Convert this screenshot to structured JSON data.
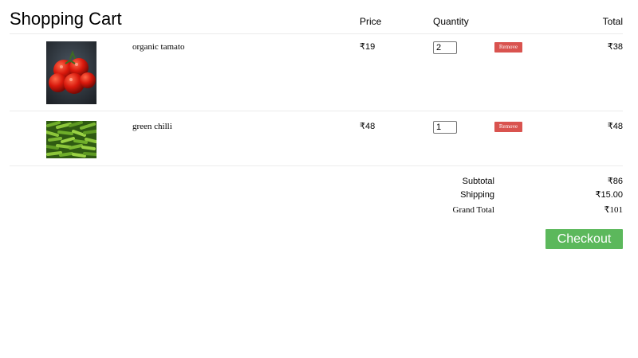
{
  "header": {
    "title": "Shopping Cart",
    "col_price": "Price",
    "col_quantity": "Quantity",
    "col_total": "Total"
  },
  "items": [
    {
      "name": "organic tamato",
      "price": "₹19",
      "quantity": "2",
      "remove_label": "Remove",
      "total": "₹38",
      "image": "tomato-photo"
    },
    {
      "name": "green chilli",
      "price": "₹48",
      "quantity": "1",
      "remove_label": "Remove",
      "total": "₹48",
      "image": "green-chilli-photo"
    }
  ],
  "summary": {
    "subtotal_label": "Subtotal",
    "subtotal_value": "₹86",
    "shipping_label": "Shipping",
    "shipping_value": "₹15.00",
    "grand_total_label": "Grand Total",
    "grand_total_value": "₹101"
  },
  "checkout": {
    "label": "Checkout"
  },
  "colors": {
    "remove_button": "#d9534f",
    "checkout_button": "#5cb85c"
  }
}
